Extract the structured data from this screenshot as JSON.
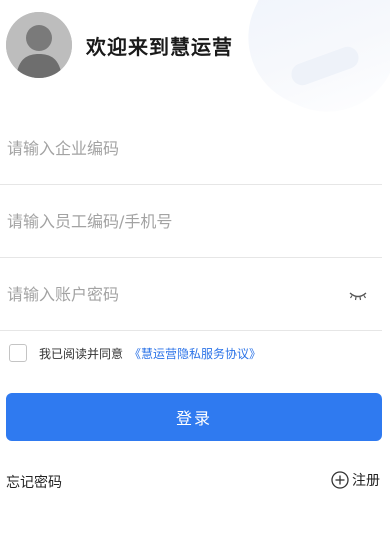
{
  "header": {
    "welcome_text": "欢迎来到慧运营",
    "avatar_icon": "user-avatar-placeholder"
  },
  "form": {
    "company_code": {
      "placeholder": "请输入企业编码",
      "value": ""
    },
    "employee_phone": {
      "placeholder": "请输入员工编码/手机号",
      "value": ""
    },
    "password": {
      "placeholder": "请输入账户密码",
      "value": "",
      "toggle_icon": "eye-closed-icon"
    }
  },
  "agreement": {
    "checked": false,
    "text": "我已阅读并同意",
    "link": "《慧运营隐私服务协议》"
  },
  "actions": {
    "login_label": "登录",
    "forgot_label": "忘记密码",
    "register_label": "注册",
    "register_icon": "plus-circle-icon"
  },
  "colors": {
    "primary": "#2f7af0",
    "link": "#2b73e8"
  }
}
